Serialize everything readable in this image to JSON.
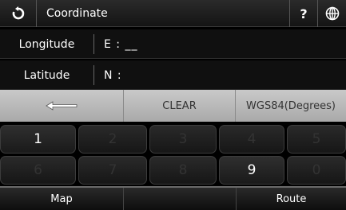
{
  "header": {
    "back_icon": "refresh-back-icon",
    "title": "Coordinate",
    "help_label": "?",
    "globe_icon": "globe-icon"
  },
  "longitude": {
    "label": "Longitude",
    "value": "E : __"
  },
  "latitude": {
    "label": "Latitude",
    "value": "N :"
  },
  "functions": {
    "backspace_icon": "left-arrow-icon",
    "clear_label": "CLEAR",
    "datum_label": "WGS84(Degrees)"
  },
  "keypad": {
    "row1": [
      "1",
      "2",
      "3",
      "4",
      "5"
    ],
    "row2": [
      "6",
      "7",
      "8",
      "9",
      "0"
    ],
    "enabled": [
      "1",
      "9"
    ]
  },
  "bottom": {
    "map_label": "Map",
    "route_label": "Route"
  }
}
